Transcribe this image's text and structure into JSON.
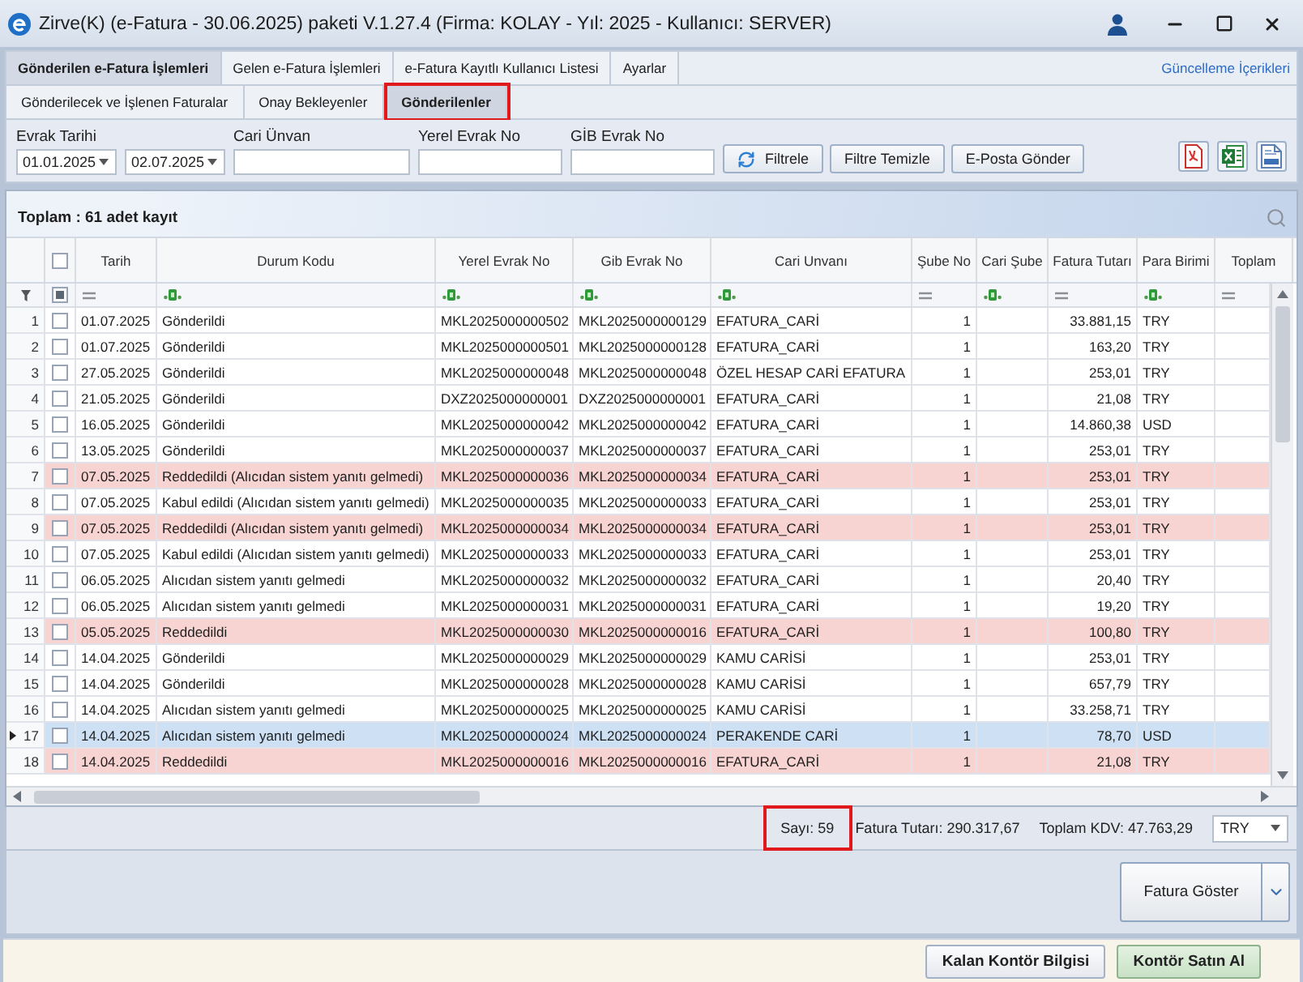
{
  "window": {
    "title": "Zirve(K) (e-Fatura - 30.06.2025) paketi V.1.27.4 (Firma: KOLAY - Yıl: 2025 - Kullanıcı: SERVER)"
  },
  "main_tabs": [
    {
      "label": "Gönderilen e-Fatura İşlemleri",
      "selected": true
    },
    {
      "label": "Gelen e-Fatura İşlemleri",
      "selected": false
    },
    {
      "label": "e-Fatura Kayıtlı Kullanıcı Listesi",
      "selected": false
    },
    {
      "label": "Ayarlar",
      "selected": false
    }
  ],
  "update_link": "Güncelleme İçerikleri",
  "sub_tabs": [
    {
      "label": "Gönderilecek ve İşlenen Faturalar",
      "selected": false,
      "highlighted": false
    },
    {
      "label": "Onay Bekleyenler",
      "selected": false,
      "highlighted": false
    },
    {
      "label": "Gönderilenler",
      "selected": true,
      "highlighted": true
    }
  ],
  "filters": {
    "date": {
      "label": "Evrak Tarihi",
      "from": "01.01.2025",
      "to": "02.07.2025"
    },
    "fields": [
      {
        "label": "Cari Ünvan"
      },
      {
        "label": "Yerel Evrak No"
      },
      {
        "label": "GİB Evrak No"
      }
    ],
    "buttons": [
      {
        "label": "Filtrele",
        "kind": "with-icon"
      },
      {
        "label": "Filtre Temizle",
        "kind": "plain"
      },
      {
        "label": "E-Posta Gönder",
        "kind": "plain"
      }
    ]
  },
  "grid": {
    "record_count": "Toplam : 61 adet kayıt",
    "header_checkbox": {
      "checked": false
    },
    "columns": [
      "Tarih",
      "Durum Kodu",
      "Yerel Evrak No",
      "Gib Evrak No",
      "Cari Unvanı",
      "Şube No",
      "Cari Şube",
      "Fatura Tutarı",
      "Para Birimi",
      "Toplam"
    ],
    "filter_row": [
      {
        "kind": "equals"
      },
      {
        "kind": "text"
      },
      {
        "kind": "text"
      },
      {
        "kind": "text"
      },
      {
        "kind": "text"
      },
      {
        "kind": "equals"
      },
      {
        "kind": "text"
      },
      {
        "kind": "equals"
      },
      {
        "kind": "text"
      },
      {
        "kind": "equals"
      }
    ],
    "rows": [
      {
        "number": "1",
        "date": "01.07.2025",
        "status": "Gönderildi",
        "local_no": "MKL2025000000502",
        "gib_no": "MKL2025000000129",
        "account": "EFATURA_CARİ",
        "branch_no": "1",
        "amount": "33.881,15",
        "currency": "TRY",
        "checked": false,
        "selected": false,
        "rejected": false
      },
      {
        "number": "2",
        "date": "01.07.2025",
        "status": "Gönderildi",
        "local_no": "MKL2025000000501",
        "gib_no": "MKL2025000000128",
        "account": "EFATURA_CARİ",
        "branch_no": "1",
        "amount": "163,20",
        "currency": "TRY",
        "checked": false,
        "selected": false,
        "rejected": false
      },
      {
        "number": "3",
        "date": "27.05.2025",
        "status": "Gönderildi",
        "local_no": "MKL2025000000048",
        "gib_no": "MKL2025000000048",
        "account": "ÖZEL HESAP CARİ EFATURA",
        "branch_no": "1",
        "amount": "253,01",
        "currency": "TRY",
        "checked": false,
        "selected": false,
        "rejected": false
      },
      {
        "number": "4",
        "date": "21.05.2025",
        "status": "Gönderildi",
        "local_no": "DXZ2025000000001",
        "gib_no": "DXZ2025000000001",
        "account": "EFATURA_CARİ",
        "branch_no": "1",
        "amount": "21,08",
        "currency": "TRY",
        "checked": false,
        "selected": false,
        "rejected": false
      },
      {
        "number": "5",
        "date": "16.05.2025",
        "status": "Gönderildi",
        "local_no": "MKL2025000000042",
        "gib_no": "MKL2025000000042",
        "account": "EFATURA_CARİ",
        "branch_no": "1",
        "amount": "14.860,38",
        "currency": "USD",
        "checked": false,
        "selected": false,
        "rejected": false
      },
      {
        "number": "6",
        "date": "13.05.2025",
        "status": "Gönderildi",
        "local_no": "MKL2025000000037",
        "gib_no": "MKL2025000000037",
        "account": "EFATURA_CARİ",
        "branch_no": "1",
        "amount": "253,01",
        "currency": "TRY",
        "checked": false,
        "selected": false,
        "rejected": false
      },
      {
        "number": "7",
        "date": "07.05.2025",
        "status": "Reddedildi (Alıcıdan sistem yanıtı gelmedi)",
        "local_no": "MKL2025000000036",
        "gib_no": "MKL2025000000034",
        "account": "EFATURA_CARİ",
        "branch_no": "1",
        "amount": "253,01",
        "currency": "TRY",
        "checked": false,
        "selected": false,
        "rejected": true
      },
      {
        "number": "8",
        "date": "07.05.2025",
        "status": "Kabul edildi (Alıcıdan sistem yanıtı gelmedi)",
        "local_no": "MKL2025000000035",
        "gib_no": "MKL2025000000033",
        "account": "EFATURA_CARİ",
        "branch_no": "1",
        "amount": "253,01",
        "currency": "TRY",
        "checked": false,
        "selected": false,
        "rejected": false
      },
      {
        "number": "9",
        "date": "07.05.2025",
        "status": "Reddedildi (Alıcıdan sistem yanıtı gelmedi)",
        "local_no": "MKL2025000000034",
        "gib_no": "MKL2025000000034",
        "account": "EFATURA_CARİ",
        "branch_no": "1",
        "amount": "253,01",
        "currency": "TRY",
        "checked": false,
        "selected": false,
        "rejected": true
      },
      {
        "number": "10",
        "date": "07.05.2025",
        "status": "Kabul edildi (Alıcıdan sistem yanıtı gelmedi)",
        "local_no": "MKL2025000000033",
        "gib_no": "MKL2025000000033",
        "account": "EFATURA_CARİ",
        "branch_no": "1",
        "amount": "253,01",
        "currency": "TRY",
        "checked": false,
        "selected": false,
        "rejected": false
      },
      {
        "number": "11",
        "date": "06.05.2025",
        "status": "Alıcıdan sistem yanıtı gelmedi",
        "local_no": "MKL2025000000032",
        "gib_no": "MKL2025000000032",
        "account": "EFATURA_CARİ",
        "branch_no": "1",
        "amount": "20,40",
        "currency": "TRY",
        "checked": false,
        "selected": false,
        "rejected": false
      },
      {
        "number": "12",
        "date": "06.05.2025",
        "status": "Alıcıdan sistem yanıtı gelmedi",
        "local_no": "MKL2025000000031",
        "gib_no": "MKL2025000000031",
        "account": "EFATURA_CARİ",
        "branch_no": "1",
        "amount": "19,20",
        "currency": "TRY",
        "checked": false,
        "selected": false,
        "rejected": false
      },
      {
        "number": "13",
        "date": "05.05.2025",
        "status": "Reddedildi",
        "local_no": "MKL2025000000030",
        "gib_no": "MKL2025000000016",
        "account": "EFATURA_CARİ",
        "branch_no": "1",
        "amount": "100,80",
        "currency": "TRY",
        "checked": false,
        "selected": false,
        "rejected": true
      },
      {
        "number": "14",
        "date": "14.04.2025",
        "status": "Gönderildi",
        "local_no": "MKL2025000000029",
        "gib_no": "MKL2025000000029",
        "account": "KAMU CARİSİ",
        "branch_no": "1",
        "amount": "253,01",
        "currency": "TRY",
        "checked": false,
        "selected": false,
        "rejected": false
      },
      {
        "number": "15",
        "date": "14.04.2025",
        "status": "Gönderildi",
        "local_no": "MKL2025000000028",
        "gib_no": "MKL2025000000028",
        "account": "KAMU CARİSİ",
        "branch_no": "1",
        "amount": "657,79",
        "currency": "TRY",
        "checked": false,
        "selected": false,
        "rejected": false
      },
      {
        "number": "16",
        "date": "14.04.2025",
        "status": "Alıcıdan sistem yanıtı gelmedi",
        "local_no": "MKL2025000000025",
        "gib_no": "MKL2025000000025",
        "account": "KAMU CARİSİ",
        "branch_no": "1",
        "amount": "33.258,71",
        "currency": "TRY",
        "checked": false,
        "selected": false,
        "rejected": false
      },
      {
        "number": "17",
        "date": "14.04.2025",
        "status": "Alıcıdan sistem yanıtı gelmedi",
        "local_no": "MKL2025000000024",
        "gib_no": "MKL2025000000024",
        "account": "PERAKENDE CARİ",
        "branch_no": "1",
        "amount": "78,70",
        "currency": "USD",
        "checked": false,
        "selected": true,
        "rejected": false
      },
      {
        "number": "18",
        "date": "14.04.2025",
        "status": "Reddedildi",
        "local_no": "MKL2025000000016",
        "gib_no": "MKL2025000000016",
        "account": "EFATURA_CARİ",
        "branch_no": "1",
        "amount": "21,08",
        "currency": "TRY",
        "checked": false,
        "selected": false,
        "rejected": true
      }
    ]
  },
  "summary": {
    "count": {
      "text": "Sayı: 59",
      "highlighted": true
    },
    "invoice_total": "Fatura Tutarı: 290.317,67",
    "vat_total": "Toplam KDV: 47.763,29",
    "currency": "TRY"
  },
  "actions": {
    "primary": "Fatura Göster"
  },
  "bottom_buttons": [
    {
      "label": "Kalan Kontör Bilgisi",
      "kind": "default"
    },
    {
      "label": "Kontör Satın Al",
      "kind": "accent"
    }
  ]
}
